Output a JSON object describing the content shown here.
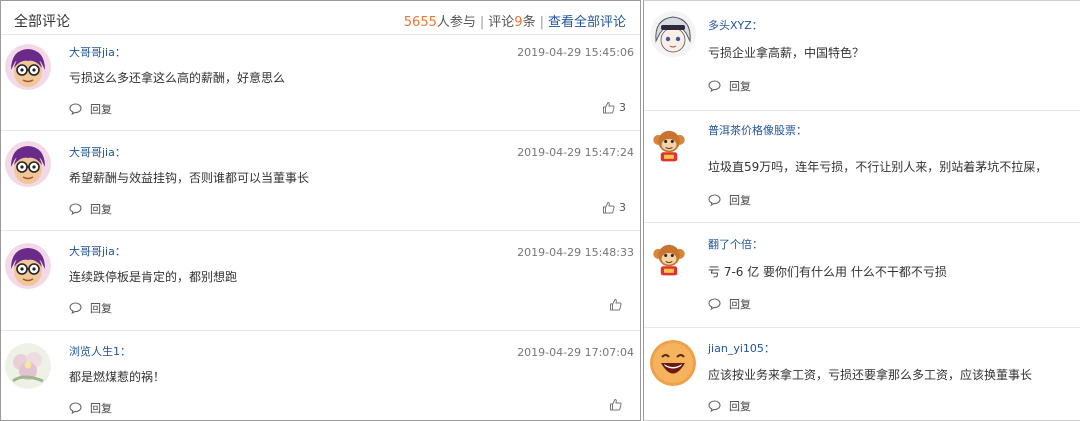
{
  "header": {
    "title": "全部评论",
    "participants": "5655",
    "participants_suffix": "人参与",
    "separator": "|",
    "comments_prefix": "评论",
    "comments_count": "9",
    "comments_suffix": "条",
    "view_all": "查看全部评论"
  },
  "left_comments": [
    {
      "user": "大哥哥jia：",
      "time": "2019-04-29 15:45:06",
      "text": "亏损这么多还拿这么高的薪酬，好意思么",
      "reply": "回复",
      "likes": "3",
      "avatar": "glasses-avatar-icon"
    },
    {
      "user": "大哥哥jia：",
      "time": "2019-04-29 15:47:24",
      "text": "希望薪酬与效益挂钩，否则谁都可以当董事长",
      "reply": "回复",
      "likes": "3",
      "avatar": "glasses-avatar-icon"
    },
    {
      "user": "大哥哥jia：",
      "time": "2019-04-29 15:48:33",
      "text": "连续跌停板是肯定的，都别想跑",
      "reply": "回复",
      "likes": "",
      "avatar": "glasses-avatar-icon"
    },
    {
      "user": "浏览人生1：",
      "time": "2019-04-29 17:07:04",
      "text": "都是燃煤惹的祸！",
      "reply": "回复",
      "likes": "",
      "avatar": "flower-avatar-icon"
    }
  ],
  "right_comments": [
    {
      "user": "多头XYZ：",
      "text": "亏损企业拿高薪，中国特色？",
      "reply": "回复",
      "avatar": "anime-avatar-icon"
    },
    {
      "user": "普洱茶价格像股票：",
      "text": "垃圾直59万吗，连年亏损，不行让别人来，别站着茅坑不拉屎，",
      "reply": "回复",
      "avatar": "monkey-avatar-icon"
    },
    {
      "user": "翻了个倍：",
      "text": "亏 7-6 亿 要你们有什么用 什么不干都不亏损",
      "reply": "回复",
      "avatar": "monkey-avatar-icon"
    },
    {
      "user": "jian_yi105：",
      "text": "应该按业务来拿工资，亏损还要拿那么多工资，应该换董事长",
      "reply": "回复",
      "avatar": "laughing-face-avatar-icon"
    }
  ],
  "colors": {
    "link": "#225599",
    "accent": "#e8783a",
    "text": "#333333",
    "meta": "#777777"
  }
}
